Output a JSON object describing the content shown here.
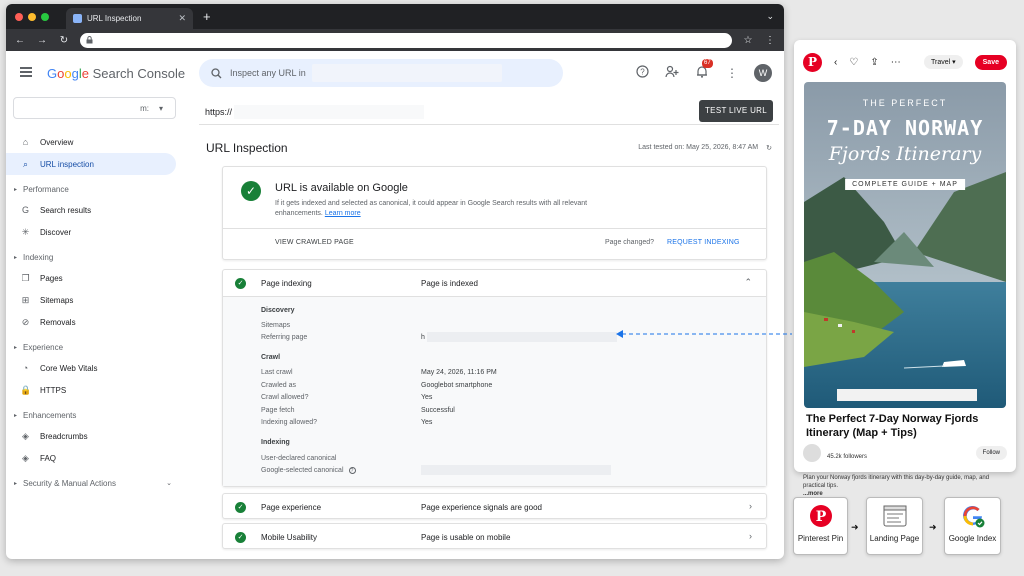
{
  "browser": {
    "tab_title": "URL Inspection",
    "tab_close": "✕",
    "new_tab": "+",
    "tab_menu": "⌄",
    "nav_back": "←",
    "nav_forward": "→",
    "nav_reload": "↻",
    "star": "☆",
    "menu": "⋮"
  },
  "header": {
    "logo_google": [
      "G",
      "o",
      "o",
      "g",
      "l",
      "e"
    ],
    "logo_product": "Search Console",
    "search_placeholder": "Inspect any URL in",
    "notifications_count": "67",
    "avatar_letter": "W"
  },
  "sidebar": {
    "property_suffix": "m:",
    "items": [
      {
        "type": "item",
        "label": "Overview",
        "icon": "home-icon",
        "glyph": "⌂"
      },
      {
        "type": "item",
        "label": "URL inspection",
        "icon": "search-icon",
        "glyph": "⌕",
        "active": true
      },
      {
        "type": "section",
        "label": "Performance"
      },
      {
        "type": "item",
        "label": "Search results",
        "icon": "google-g-icon",
        "glyph": "G"
      },
      {
        "type": "item",
        "label": "Discover",
        "icon": "asterisk-icon",
        "glyph": "✳"
      },
      {
        "type": "section",
        "label": "Indexing"
      },
      {
        "type": "item",
        "label": "Pages",
        "icon": "pages-icon",
        "glyph": "❐"
      },
      {
        "type": "item",
        "label": "Sitemaps",
        "icon": "sitemap-icon",
        "glyph": "⊞"
      },
      {
        "type": "item",
        "label": "Removals",
        "icon": "removals-icon",
        "glyph": "⊘"
      },
      {
        "type": "section",
        "label": "Experience"
      },
      {
        "type": "item",
        "label": "Core Web Vitals",
        "icon": "gauge-icon",
        "glyph": "◔"
      },
      {
        "type": "item",
        "label": "HTTPS",
        "icon": "lock-icon",
        "glyph": "🔒"
      },
      {
        "type": "section",
        "label": "Enhancements"
      },
      {
        "type": "item",
        "label": "Breadcrumbs",
        "icon": "layers-icon",
        "glyph": "◈"
      },
      {
        "type": "item",
        "label": "FAQ",
        "icon": "layers-icon",
        "glyph": "◈"
      },
      {
        "type": "section",
        "label": "Security & Manual Actions",
        "expandable": true
      }
    ]
  },
  "main": {
    "url_prefix": "https://",
    "test_live_url": "TEST LIVE URL",
    "title": "URL Inspection",
    "last_tested": "Last tested on: May 25, 2026, 8:47 AM",
    "status": {
      "title": "URL is available on Google",
      "desc": "If it gets indexed and selected as canonical, it could appear in Google Search results with all relevant enhancements.",
      "learn_more": "Learn more",
      "view_crawled": "VIEW CRAWLED PAGE",
      "page_changed": "Page changed?",
      "request_indexing": "REQUEST INDEXING"
    },
    "indexing": {
      "label": "Page indexing",
      "value": "Page is indexed",
      "discovery_heading": "Discovery",
      "sitemaps_label": "Sitemaps",
      "referring_label": "Referring page",
      "referring_value_prefix": "h",
      "crawl_heading": "Crawl",
      "crawl_rows": [
        {
          "label": "Last crawl",
          "value": "May 24, 2026, 11:16 PM"
        },
        {
          "label": "Crawled as",
          "value": "Googlebot smartphone"
        },
        {
          "label": "Crawl allowed?",
          "value": "Yes"
        },
        {
          "label": "Page fetch",
          "value": "Successful"
        },
        {
          "label": "Indexing allowed?",
          "value": "Yes"
        }
      ],
      "indexing_heading": "Indexing",
      "user_canonical_label": "User-declared canonical",
      "google_canonical_label": "Google-selected canonical"
    },
    "experience": {
      "label": "Page experience",
      "value": "Page experience signals are good"
    },
    "mobile": {
      "label": "Mobile Usability",
      "value": "Page is usable on mobile"
    }
  },
  "pin": {
    "board": "Travel",
    "save": "Save",
    "img_line1": "THE PERFECT",
    "img_line2": "7-DAY NORWAY",
    "img_line3": "Fjords Itinerary",
    "img_line4": "COMPLETE GUIDE + MAP",
    "title": "The Perfect 7-Day Norway Fjords Itinerary (Map + Tips)",
    "followers": "45.2k followers",
    "follow": "Follow",
    "desc": "Plan your Norway fjords itinerary with this day-by-day guide, map, and practical tips.",
    "more": "...more"
  },
  "flow": {
    "step1": "Pinterest Pin",
    "step2": "Landing Page",
    "step3": "Google Index",
    "arrow": "➜"
  }
}
